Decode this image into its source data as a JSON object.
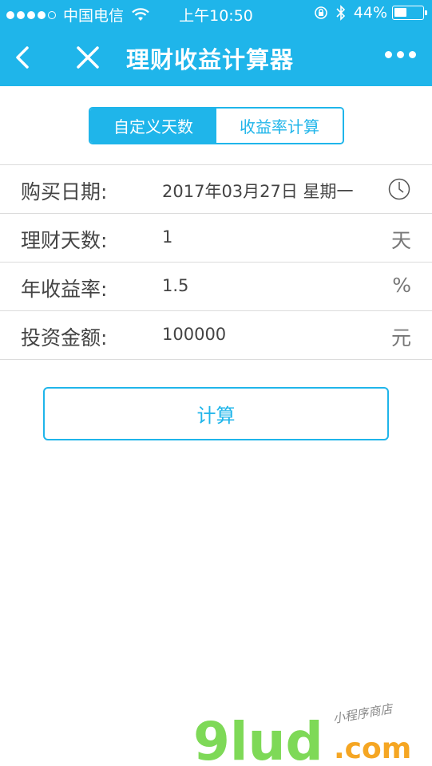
{
  "status_bar": {
    "carrier": "中国电信",
    "time": "上午10:50",
    "battery": "44%",
    "battery_level": 0.44
  },
  "navbar": {
    "title": "理财收益计算器"
  },
  "segment": {
    "tab_custom_days": "自定义天数",
    "tab_rate_calc": "收益率计算"
  },
  "form": {
    "purchase_date": {
      "label": "购买日期:",
      "value": "2017年03月27日 星期一"
    },
    "days": {
      "label": "理财天数:",
      "value": "1",
      "unit": "天"
    },
    "rate": {
      "label": "年收益率:",
      "value": "1.5",
      "unit": "%"
    },
    "amount": {
      "label": "投资金额:",
      "value": "100000",
      "unit": "元"
    }
  },
  "actions": {
    "calculate_label": "计算"
  },
  "watermark": {
    "brand": "9lud",
    "domain": ".com",
    "tagline": "小程序商店"
  },
  "colors": {
    "accent": "#1fb5ea",
    "watermark_green": "#7ed957",
    "watermark_orange": "#f5a623"
  }
}
